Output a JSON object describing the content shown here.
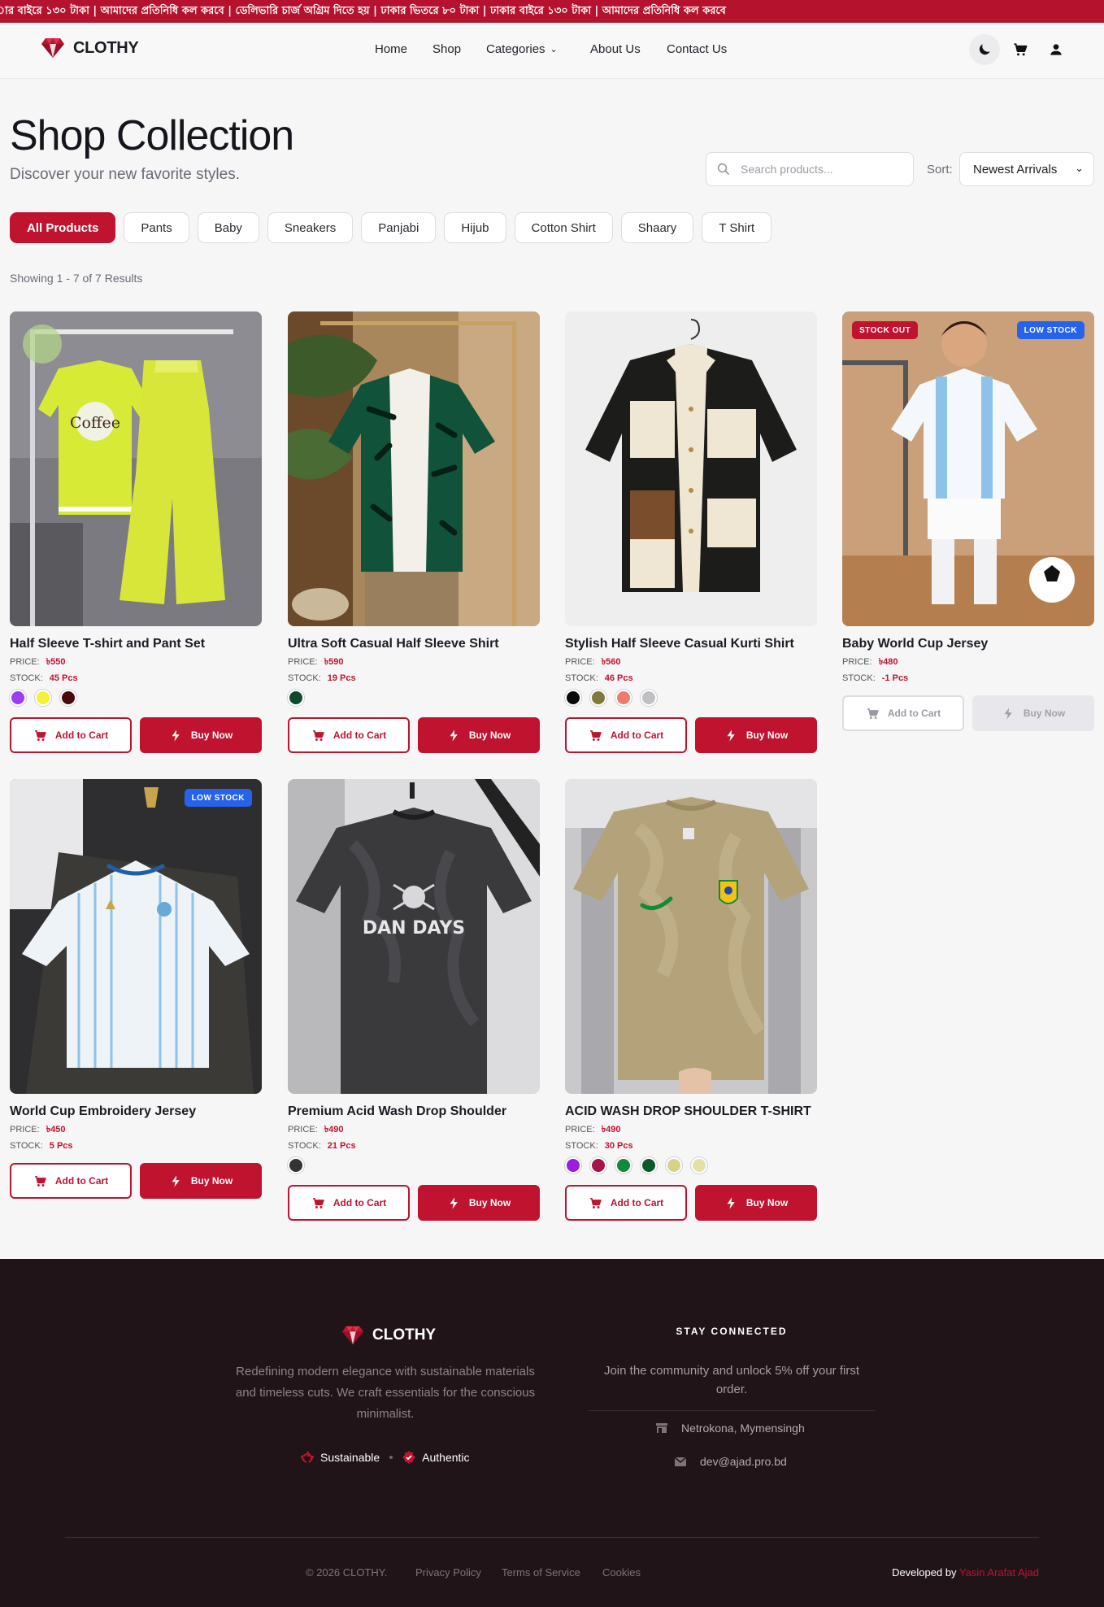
{
  "announcement": "ার বাইরে ১৩০ টাকা | আমাদের প্রতিনিধি কল করবে | ডেলিভারি চার্জ অগ্রিম দিতে হয় | ঢাকার ভিতরে ৮০ টাকা | ঢাকার বাইরে ১৩০ টাকা | আমাদের প্রতিনিধি কল করবে",
  "brand": "CLOTHY",
  "nav": {
    "home": "Home",
    "shop": "Shop",
    "categories": "Categories",
    "about": "About Us",
    "contact": "Contact Us"
  },
  "header_icons": [
    "moon-icon",
    "cart-icon",
    "user-icon"
  ],
  "page": {
    "title": "Shop Collection",
    "subtitle": "Discover your new favorite styles.",
    "search_placeholder": "Search products...",
    "sort_label": "Sort:",
    "sort_value": "Newest Arrivals",
    "results": "Showing 1 - 7 of 7 Results"
  },
  "categories": [
    "All Products",
    "Pants",
    "Baby",
    "Sneakers",
    "Panjabi",
    "Hijub",
    "Cotton Shirt",
    "Shaary",
    "T Shirt"
  ],
  "active_category": "All Products",
  "labels": {
    "price": "PRICE:",
    "stock": "STOCK:",
    "add_to_cart": "Add to Cart",
    "buy_now": "Buy Now",
    "stock_out": "STOCK OUT",
    "low_stock": "LOW STOCK"
  },
  "products": [
    {
      "name": "Half Sleeve T-shirt and Pant Set",
      "price": "৳550",
      "stock": "45 Pcs",
      "colors": [
        "#9b3df0",
        "#f2f23a",
        "#4a0a0a"
      ],
      "badges": [],
      "available": true
    },
    {
      "name": "Ultra Soft Casual Half Sleeve Shirt",
      "price": "৳590",
      "stock": "19 Pcs",
      "colors": [
        "#0f4a2f"
      ],
      "badges": [],
      "available": true
    },
    {
      "name": "Stylish Half Sleeve Casual Kurti Shirt",
      "price": "৳560",
      "stock": "46 Pcs",
      "colors": [
        "#0a0a0a",
        "#7d7a3a",
        "#f07a6e",
        "#c0c0c4"
      ],
      "badges": [],
      "available": true
    },
    {
      "name": "Baby World Cup Jersey",
      "price": "৳480",
      "stock": "-1 Pcs",
      "colors": [],
      "badges": [
        "stock_out",
        "low_stock"
      ],
      "available": false
    },
    {
      "name": "World Cup Embroidery Jersey",
      "price": "৳450",
      "stock": "5 Pcs",
      "colors": [],
      "badges": [
        "low_stock"
      ],
      "available": true
    },
    {
      "name": "Premium Acid Wash Drop Shoulder",
      "price": "৳490",
      "stock": "21 Pcs",
      "colors": [
        "#333333"
      ],
      "badges": [],
      "available": true
    },
    {
      "name": "ACID WASH DROP SHOULDER T-SHIRT",
      "price": "৳490",
      "stock": "30 Pcs",
      "colors": [
        "#9b1ee0",
        "#a8124a",
        "#128a3a",
        "#0a5a2a",
        "#d6d28a",
        "#e4e0a8"
      ],
      "badges": [],
      "available": true
    }
  ],
  "footer": {
    "brand": "CLOTHY",
    "description": "Redefining modern elegance with sustainable materials and timeless cuts. We craft essentials for the conscious minimalist.",
    "tag1": "Sustainable",
    "tag2": "Authentic",
    "stay": "STAY CONNECTED",
    "join": "Join the community and unlock 5% off your first order.",
    "location": "Netrokona, Mymensingh",
    "email": "dev@ajad.pro.bd",
    "copyright": "© 2026 CLOTHY.",
    "privacy": "Privacy Policy",
    "terms": "Terms of Service",
    "cookies": "Cookies",
    "developed_by": "Developed by",
    "developer": "Yasin Arafat Ajad"
  },
  "colors": {
    "brand": "#c0132f",
    "footer_bg": "#211418",
    "low_stock": "#2563eb"
  }
}
